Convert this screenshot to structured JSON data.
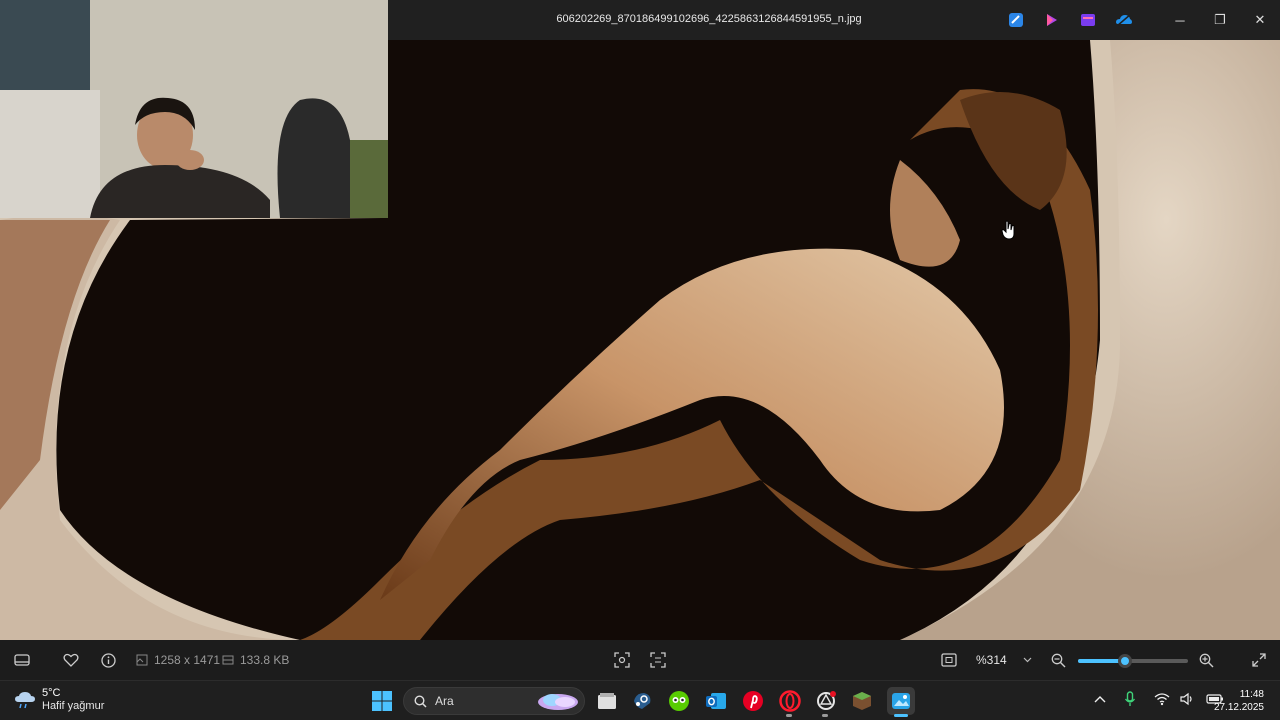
{
  "window": {
    "title": "606202269_870186499102696_4225863126844591955_n.jpg",
    "actions": [
      {
        "name": "designer-icon"
      },
      {
        "name": "clipchamp-icon"
      },
      {
        "name": "video-editor-icon"
      },
      {
        "name": "onedrive-icon"
      }
    ],
    "controls": {
      "minimize": "─",
      "maximize": "❐",
      "close": "✕"
    }
  },
  "toolbar": {
    "dimensions": "1258 x 1471",
    "file_size": "133.8 KB",
    "zoom": "%314",
    "zoom_level": 0.43
  },
  "taskbar": {
    "weather_temp": "5°C",
    "weather_desc": "Hafif yağmur",
    "search_placeholder": "Ara",
    "time": "11:48",
    "date": "27.12.2025",
    "apps": [
      {
        "name": "file-explorer-icon",
        "color": "#d9d9d9"
      },
      {
        "name": "steam-icon",
        "color": "#1b4c7a"
      },
      {
        "name": "duolingo-icon",
        "color": "#58cc02"
      },
      {
        "name": "outlook-icon",
        "color": "#0f6cbd"
      },
      {
        "name": "pinterest-icon",
        "color": "#e60023"
      },
      {
        "name": "opera-icon",
        "color": "#ff1b2d"
      },
      {
        "name": "chatgpt-icon",
        "color": "#e5e5e5"
      },
      {
        "name": "minecraft-icon",
        "color": "#6a9a3a"
      },
      {
        "name": "photos-icon",
        "color": "#2aa4e8"
      }
    ]
  },
  "colors": {
    "accent": "#4cc2ff",
    "toolbar_bg": "#1c1c1c",
    "titlebar_bg": "#202020"
  }
}
